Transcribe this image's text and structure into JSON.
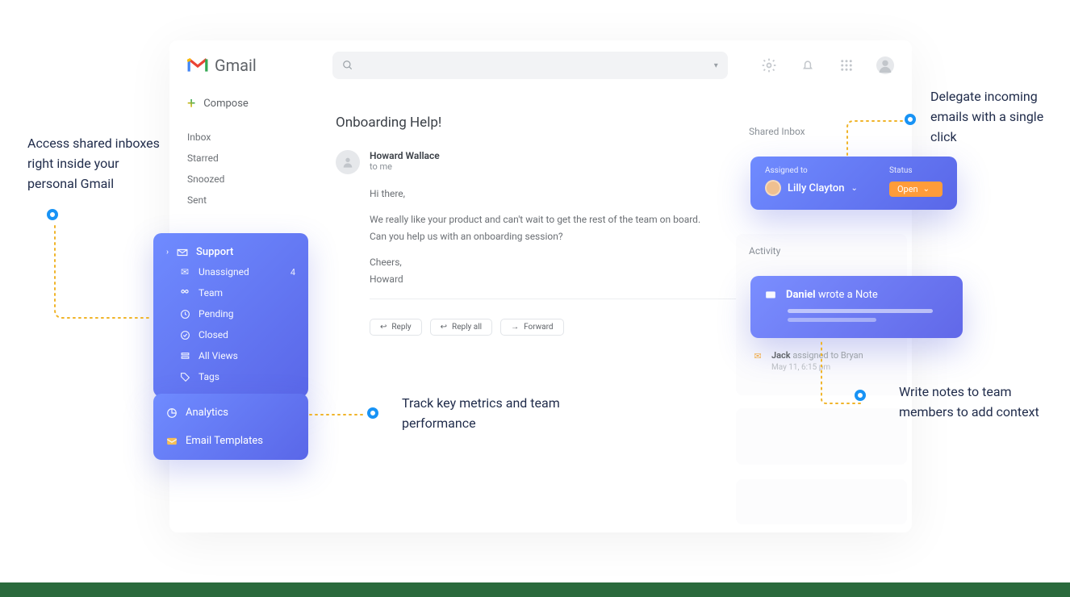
{
  "app": {
    "name": "Gmail"
  },
  "search": {
    "placeholder": ""
  },
  "compose": {
    "label": "Compose"
  },
  "nav": {
    "inbox": "Inbox",
    "starred": "Starred",
    "snoozed": "Snoozed",
    "sent": "Sent"
  },
  "shared_sidebar": {
    "title": "Support",
    "items": [
      {
        "label": "Unassigned",
        "count": "4"
      },
      {
        "label": "Team"
      },
      {
        "label": "Pending"
      },
      {
        "label": "Closed"
      },
      {
        "label": "All Views"
      },
      {
        "label": "Tags"
      }
    ]
  },
  "tools": {
    "analytics": "Analytics",
    "templates": "Email Templates"
  },
  "email": {
    "subject": "Onboarding Help!",
    "sender": "Howard Wallace",
    "recipient": "to me",
    "greeting": "Hi there,",
    "body_line1": "We really like your product and can't wait to get the rest of the team on board.",
    "body_line2": "Can you help us with an onboarding session?",
    "signoff": "Cheers,",
    "signature": "Howard",
    "actions": {
      "reply": "Reply",
      "reply_all": "Reply all",
      "forward": "Forward"
    }
  },
  "right": {
    "shared_inbox_label": "Shared Inbox",
    "assigned": {
      "label": "Assigned to",
      "user": "Lilly Clayton",
      "status_label": "Status",
      "status_value": "Open"
    },
    "activity_label": "Activity",
    "note": {
      "author": "Daniel",
      "verb": "wrote a Note"
    },
    "activity_item": {
      "name": "Jack",
      "text": "assigned to Bryan",
      "ts": "May 11, 6:15 pm"
    }
  },
  "callouts": {
    "c1": "Access shared inboxes right inside your personal Gmail",
    "c2": "Track key metrics and team performance",
    "c3": "Delegate incoming emails with a single click",
    "c4": "Write notes to team members to add context"
  }
}
